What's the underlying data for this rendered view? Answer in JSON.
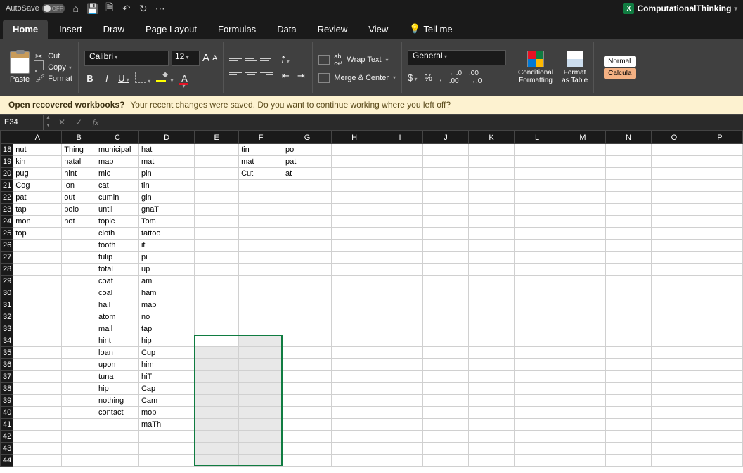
{
  "titlebar": {
    "autosave_label": "AutoSave",
    "autosave_state": "OFF",
    "workbook_name": "ComputationalThinking"
  },
  "tabs": [
    "Home",
    "Insert",
    "Draw",
    "Page Layout",
    "Formulas",
    "Data",
    "Review",
    "View"
  ],
  "tellme": "Tell me",
  "clipboard": {
    "paste": "Paste",
    "cut": "Cut",
    "copy": "Copy",
    "format": "Format"
  },
  "font": {
    "name": "Calibri",
    "size": "12"
  },
  "alignment": {
    "wrap": "Wrap Text",
    "merge": "Merge & Center"
  },
  "number": {
    "format": "General"
  },
  "styles": {
    "conditional": "Conditional\nFormatting",
    "table": "Format\nas Table",
    "normal": "Normal",
    "calc": "Calcula"
  },
  "msgbar": {
    "title": "Open recovered workbooks?",
    "body": "Your recent changes were saved. Do you want to continue working where you left off?"
  },
  "namebox": "E34",
  "columns": [
    "A",
    "B",
    "C",
    "D",
    "E",
    "F",
    "G",
    "H",
    "I",
    "J",
    "K",
    "L",
    "M",
    "N",
    "O",
    "P"
  ],
  "rows": [
    {
      "n": 18,
      "c": {
        "A": "nut",
        "B": "Thing",
        "C": "municipal",
        "D": "hat",
        "F": "tin",
        "G": "pol"
      }
    },
    {
      "n": 19,
      "c": {
        "A": "kin",
        "B": "natal",
        "C": "map",
        "D": "mat",
        "F": "mat",
        "G": "pat"
      }
    },
    {
      "n": 20,
      "c": {
        "A": "pug",
        "B": "hint",
        "C": "mic",
        "D": "pin",
        "F": "Cut",
        "G": "at"
      }
    },
    {
      "n": 21,
      "c": {
        "A": "Cog",
        "B": "ion",
        "C": "cat",
        "D": "tin"
      }
    },
    {
      "n": 22,
      "c": {
        "A": "pat",
        "B": "out",
        "C": "cumin",
        "D": "gin"
      }
    },
    {
      "n": 23,
      "c": {
        "A": "tap",
        "B": "polo",
        "C": "until",
        "D": "gnaT"
      }
    },
    {
      "n": 24,
      "c": {
        "A": "mon",
        "B": "hot",
        "C": "topic",
        "D": "Tom"
      }
    },
    {
      "n": 25,
      "c": {
        "A": "top",
        "C": "cloth",
        "D": "tattoo"
      }
    },
    {
      "n": 26,
      "c": {
        "C": "tooth",
        "D": "it"
      }
    },
    {
      "n": 27,
      "c": {
        "C": "tulip",
        "D": "pi"
      }
    },
    {
      "n": 28,
      "c": {
        "C": "total",
        "D": "up"
      }
    },
    {
      "n": 29,
      "c": {
        "C": "coat",
        "D": "am"
      }
    },
    {
      "n": 30,
      "c": {
        "C": "coal",
        "D": "ham"
      }
    },
    {
      "n": 31,
      "c": {
        "C": "hail",
        "D": "map"
      }
    },
    {
      "n": 32,
      "c": {
        "C": "atom",
        "D": "no"
      }
    },
    {
      "n": 33,
      "c": {
        "C": "mail",
        "D": "tap"
      }
    },
    {
      "n": 34,
      "c": {
        "C": "hint",
        "D": "hip"
      }
    },
    {
      "n": 35,
      "c": {
        "C": "loan",
        "D": "Cup"
      }
    },
    {
      "n": 36,
      "c": {
        "C": "upon",
        "D": "him"
      }
    },
    {
      "n": 37,
      "c": {
        "C": "tuna",
        "D": "hiT"
      }
    },
    {
      "n": 38,
      "c": {
        "C": "hip",
        "D": "Cap"
      }
    },
    {
      "n": 39,
      "c": {
        "C": "nothing",
        "D": "Cam"
      }
    },
    {
      "n": 40,
      "c": {
        "C": "contact",
        "D": "mop"
      }
    },
    {
      "n": 41,
      "c": {
        "D": "maTh"
      }
    },
    {
      "n": 42,
      "c": {}
    },
    {
      "n": 43,
      "c": {}
    },
    {
      "n": 44,
      "c": {}
    }
  ],
  "selection": {
    "startRow": 34,
    "endRow": 44,
    "startCol": "E",
    "endCol": "F"
  }
}
